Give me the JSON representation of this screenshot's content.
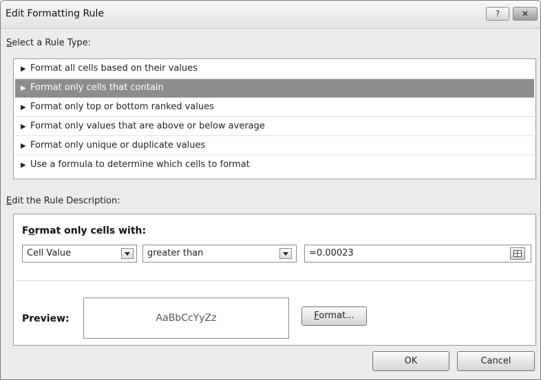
{
  "window": {
    "title": "Edit Formatting Rule",
    "help_label": "?",
    "close_label": "✕"
  },
  "rule_type": {
    "label_first": "S",
    "label_rest": "elect a Rule Type:",
    "items": [
      {
        "label": "Format all cells based on their values",
        "selected": false
      },
      {
        "label": "Format only cells that contain",
        "selected": true
      },
      {
        "label": "Format only top or bottom ranked values",
        "selected": false
      },
      {
        "label": "Format only values that are above or below average",
        "selected": false
      },
      {
        "label": "Format only unique or duplicate values",
        "selected": false
      },
      {
        "label": "Use a formula to determine which cells to format",
        "selected": false
      }
    ]
  },
  "description": {
    "label_first": "E",
    "label_rest": "dit the Rule Description:",
    "heading_a": "F",
    "heading_b": "o",
    "heading_c": "rmat only cells with:",
    "condition_field": "Cell Value",
    "operator": "greater than",
    "value": "=0.00023",
    "preview_label": "Preview:",
    "preview_text": "AaBbCcYyZz",
    "format_button_first": "F",
    "format_button_rest": "ormat..."
  },
  "buttons": {
    "ok": "OK",
    "cancel": "Cancel"
  },
  "colors": {
    "selected_row": "#8d8d8d",
    "dialog_bg": "#ececec"
  }
}
